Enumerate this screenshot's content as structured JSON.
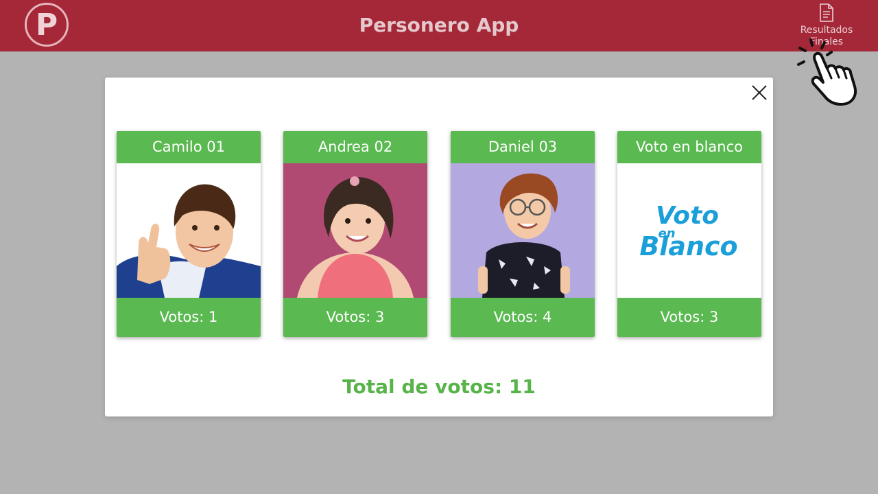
{
  "header": {
    "logo_letter": "P",
    "title": "Personero App",
    "results_label": "Resultados Finales",
    "results_icon": "document-icon"
  },
  "modal": {
    "close_icon": "close-icon",
    "candidates": [
      {
        "name": "Camilo 01",
        "votes": "Votos: 1"
      },
      {
        "name": "Andrea 02",
        "votes": "Votos: 3"
      },
      {
        "name": "Daniel 03",
        "votes": "Votos: 4"
      },
      {
        "name": "Voto en blanco",
        "votes": "Votos: 3"
      }
    ],
    "blank_logo": {
      "line1": "Voto",
      "line2": "en",
      "line3": "Blanco"
    },
    "total": "Total de votos: 11"
  },
  "colors": {
    "header_bg": "#a52838",
    "accent_green": "#5ab950",
    "total_green": "#58b44a",
    "overlay_gray": "#b3b3b3",
    "blank_blue": "#1a9fd9"
  }
}
